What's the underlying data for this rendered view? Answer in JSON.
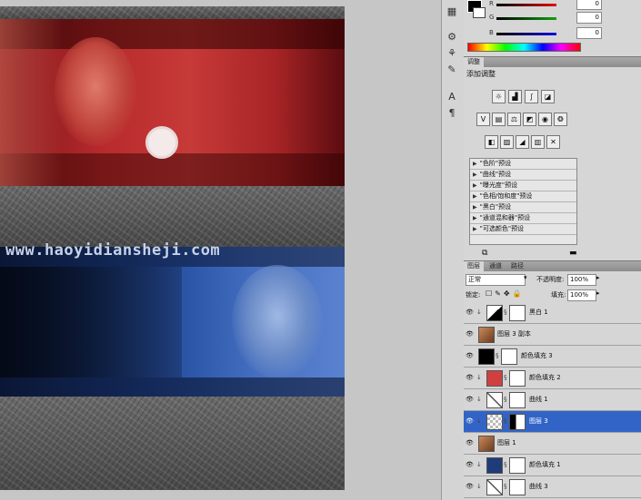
{
  "watermark": "www.haoyidiansheji.com",
  "color_panel": {
    "sliders": [
      {
        "label": "R",
        "value": "0",
        "color": "#e01010"
      },
      {
        "label": "G",
        "value": "0",
        "color": "#10a010"
      },
      {
        "label": "B",
        "value": "0",
        "color": "#1010e0"
      }
    ]
  },
  "adjustments": {
    "tab": "调整",
    "title": "添加调整",
    "presets": [
      "\"色阶\"预设",
      "\"曲线\"预设",
      "\"曝光度\"预设",
      "\"色相/饱和度\"预设",
      "\"黑白\"预设",
      "\"通道混和器\"预设",
      "\"可选颜色\"预设"
    ]
  },
  "layers_panel": {
    "tabs": [
      "图层",
      "通道",
      "路径"
    ],
    "blend_mode": "正常",
    "opacity_label": "不透明度:",
    "opacity_value": "100%",
    "lock_label": "锁定:",
    "fill_label": "填充:",
    "fill_value": "100%",
    "layers": [
      {
        "name": "黑白 1",
        "thumb": "adjust-bw",
        "mask": true,
        "clipped": true,
        "selected": false
      },
      {
        "name": "图层 3 副本",
        "thumb": "person",
        "mask": false,
        "clipped": false,
        "selected": false
      },
      {
        "name": "颜色填充 3",
        "thumb": "#000000",
        "mask": true,
        "clipped": false,
        "selected": false
      },
      {
        "name": "颜色填充 2",
        "thumb": "#d04040",
        "mask": true,
        "clipped": true,
        "selected": false
      },
      {
        "name": "曲线 1",
        "thumb": "curves",
        "mask": true,
        "clipped": true,
        "selected": false
      },
      {
        "name": "图层 3",
        "thumb": "checker",
        "mask": true,
        "clipped": true,
        "selected": true
      },
      {
        "name": "图层 1",
        "thumb": "person",
        "mask": false,
        "clipped": false,
        "selected": false
      },
      {
        "name": "颜色填充 1",
        "thumb": "#1f3c78",
        "mask": true,
        "clipped": true,
        "selected": false
      },
      {
        "name": "曲线 3",
        "thumb": "curves",
        "mask": true,
        "clipped": true,
        "selected": false
      }
    ]
  }
}
